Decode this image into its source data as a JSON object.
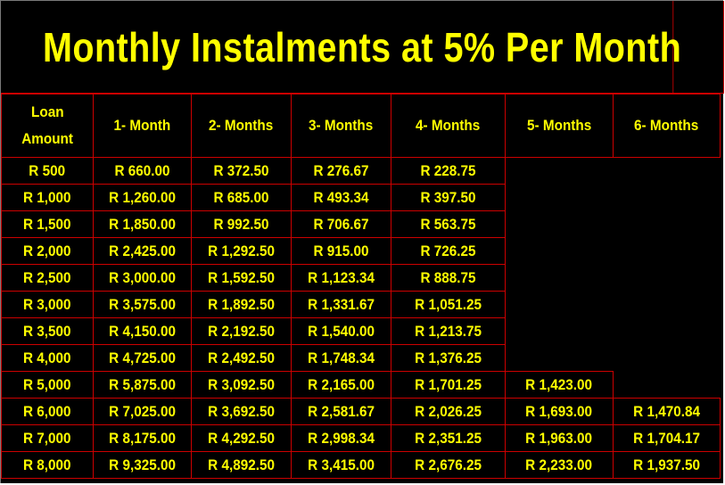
{
  "title": "Monthly Instalments at 5% Per Month",
  "colors": {
    "background": "#000000",
    "text": "#ffff00",
    "grid": "#cc0000"
  },
  "header": {
    "loan_line1": "Loan",
    "loan_line2": "Amount",
    "months": [
      "1- Month",
      "2- Months",
      "3- Months",
      "4- Months",
      "5- Months",
      "6- Months"
    ]
  },
  "rows": [
    {
      "loan": "R 500",
      "values": [
        "R 660.00",
        "R 372.50",
        "R 276.67",
        "R 228.75",
        "",
        ""
      ]
    },
    {
      "loan": "R 1,000",
      "values": [
        "R 1,260.00",
        "R 685.00",
        "R 493.34",
        "R 397.50",
        "",
        ""
      ]
    },
    {
      "loan": "R 1,500",
      "values": [
        "R 1,850.00",
        "R 992.50",
        "R 706.67",
        "R 563.75",
        "",
        ""
      ]
    },
    {
      "loan": "R 2,000",
      "values": [
        "R 2,425.00",
        "R 1,292.50",
        "R 915.00",
        "R 726.25",
        "",
        ""
      ]
    },
    {
      "loan": "R 2,500",
      "values": [
        "R 3,000.00",
        "R 1,592.50",
        "R 1,123.34",
        "R 888.75",
        "",
        ""
      ]
    },
    {
      "loan": "R 3,000",
      "values": [
        "R 3,575.00",
        "R 1,892.50",
        "R 1,331.67",
        "R 1,051.25",
        "",
        ""
      ]
    },
    {
      "loan": "R 3,500",
      "values": [
        "R 4,150.00",
        "R 2,192.50",
        "R 1,540.00",
        "R 1,213.75",
        "",
        ""
      ]
    },
    {
      "loan": "R 4,000",
      "values": [
        "R 4,725.00",
        "R 2,492.50",
        "R 1,748.34",
        "R 1,376.25",
        "",
        ""
      ]
    },
    {
      "loan": "R 5,000",
      "values": [
        "R 5,875.00",
        "R 3,092.50",
        "R 2,165.00",
        "R 1,701.25",
        "R 1,423.00",
        ""
      ]
    },
    {
      "loan": "R 6,000",
      "values": [
        "R 7,025.00",
        "R 3,692.50",
        "R 2,581.67",
        "R 2,026.25",
        "R 1,693.00",
        "R 1,470.84"
      ]
    },
    {
      "loan": "R 7,000",
      "values": [
        "R 8,175.00",
        "R 4,292.50",
        "R 2,998.34",
        "R 2,351.25",
        "R 1,963.00",
        "R 1,704.17"
      ]
    },
    {
      "loan": "R 8,000",
      "values": [
        "R 9,325.00",
        "R 4,892.50",
        "R 3,415.00",
        "R 2,676.25",
        "R 2,233.00",
        "R 1,937.50"
      ]
    }
  ]
}
